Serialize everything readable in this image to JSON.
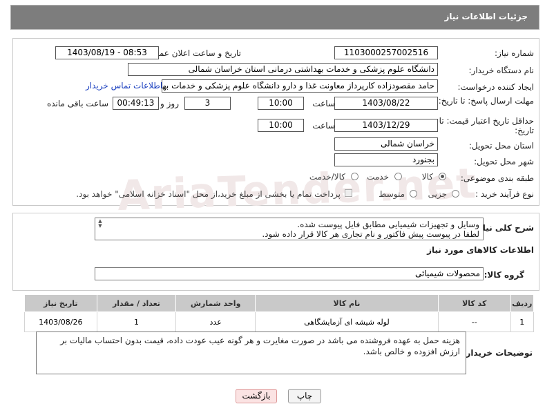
{
  "header": {
    "title": "جزئیات اطلاعات نیاز"
  },
  "watermark": "AriaTender.net",
  "form": {
    "need_number_label": "شماره نیاز:",
    "need_number": "1103000257002516",
    "announce_label": "تاریخ و ساعت اعلان عمومی:",
    "announce_value": "1403/08/19 - 08:53",
    "buyer_org_label": "نام دستگاه خریدار:",
    "buyer_org": "دانشگاه علوم پزشکی و خدمات بهداشتی درمانی استان خراسان شمالی",
    "requester_label": "ایجاد کننده درخواست:",
    "requester": "حامد مقصودزاده کارپرداز معاونت غذا و دارو دانشگاه علوم پزشکی و خدمات بهداشتی",
    "contact_link": "اطلاعات تماس خریدار",
    "deadline_label": "مهلت ارسال پاسخ: تا تاریخ:",
    "deadline_date": "1403/08/22",
    "time_label": "ساعت",
    "deadline_time": "10:00",
    "days_value": "3",
    "days_label": "روز و",
    "remaining_value": "00:49:13",
    "remaining_label": "ساعت باقی مانده",
    "validity_label": "حداقل تاریخ اعتبار قیمت: تا تاریخ:",
    "validity_date": "1403/12/29",
    "validity_time": "10:00",
    "province_label": "استان محل تحویل:",
    "province": "خراسان شمالی",
    "city_label": "شهر محل تحویل:",
    "city": "بجنورد",
    "category_label": "طبقه بندی موضوعی:",
    "category_options": [
      "کالا",
      "خدمت",
      "کالا/خدمت"
    ],
    "process_label": "نوع فرآیند خرید :",
    "process_options": [
      "جزیی",
      "متوسط"
    ],
    "payment_note": "پرداخت تمام یا بخشی از مبلغ خرید،از محل \"اسناد خزانه اسلامی\" خواهد بود."
  },
  "description": {
    "label": "شرح کلی نیاز:",
    "line1": "وسایل و تجهیزات شیمیایی مطابق فایل پیوست شده.",
    "line2": "لطفا در پیوست پیش فاکتور و نام تجاری هر کالا قرار داده شود."
  },
  "goods": {
    "section_title": "اطلاعات کالاهای مورد نیاز",
    "group_label": "گروه کالا:",
    "group_value": "محصولات شیمیائی",
    "columns": [
      "ردیف",
      "کد کالا",
      "نام کالا",
      "واحد شمارش",
      "تعداد / مقدار",
      "تاریخ نیاز"
    ],
    "rows": [
      {
        "row": "1",
        "code": "--",
        "name": "لوله شیشه ای آزمایشگاهی",
        "unit": "عدد",
        "qty": "1",
        "date": "1403/08/26"
      }
    ]
  },
  "buyer_notes": {
    "label": "توضیحات خریدار:",
    "text": "هزینه حمل به عهده فروشنده می باشد در صورت مغایرت و هر گونه عیب عودت داده، قیمت بدون احتساب مالیات بر ارزش افزوده و خالص باشد."
  },
  "buttons": {
    "print": "چاپ",
    "back": "بازگشت"
  }
}
